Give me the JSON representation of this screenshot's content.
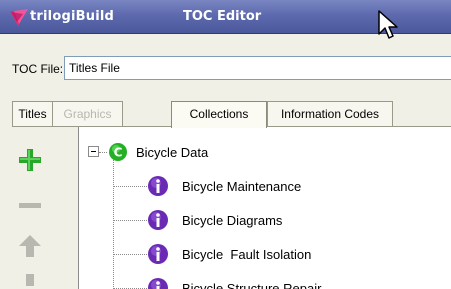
{
  "window": {
    "app_name": "trilogiBuild",
    "title": "TOC Editor"
  },
  "toc_file": {
    "label": "TOC File:",
    "value": "Titles File"
  },
  "tabs": [
    {
      "label": "Titles",
      "state": "normal"
    },
    {
      "label": "Graphics",
      "state": "disabled"
    },
    {
      "label": "Collections",
      "state": "active"
    },
    {
      "label": "Information Codes",
      "state": "normal"
    }
  ],
  "toolbar": {
    "add_icon": "plus-icon",
    "remove_icon": "minus-icon",
    "move_up_icon": "arrow-up-icon",
    "move_down_icon": "arrow-down-icon"
  },
  "tree": {
    "root": {
      "label": "Bicycle Data",
      "icon": "collection-icon",
      "expanded": true
    },
    "items": [
      {
        "label": "Bicycle Maintenance",
        "icon": "info-icon"
      },
      {
        "label": "Bicycle Diagrams",
        "icon": "info-icon"
      },
      {
        "label": "Bicycle  Fault Isolation",
        "icon": "info-icon"
      },
      {
        "label": "Bicycle Structure Repair",
        "icon": "info-icon"
      }
    ]
  },
  "colors": {
    "titlebar": "#5d6aae",
    "add_green": "#28a828",
    "collection_green": "#24b024",
    "info_purple": "#6a2ab4"
  }
}
